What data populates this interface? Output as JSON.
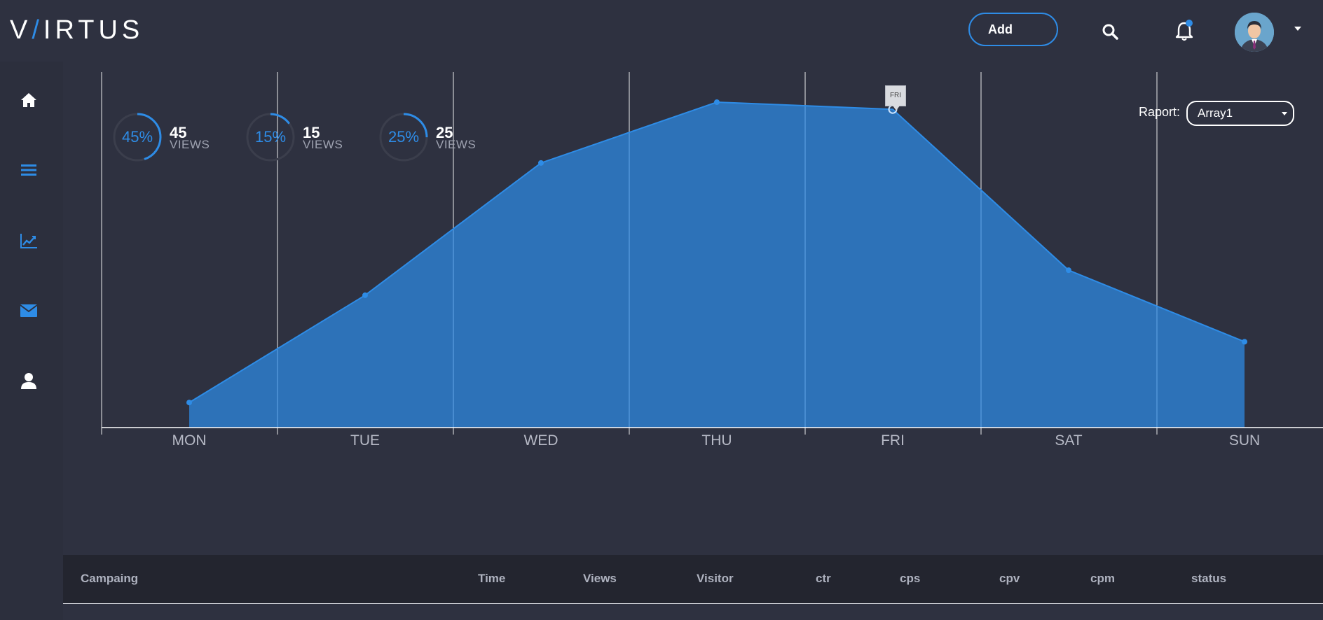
{
  "header": {
    "logo_pre": "V",
    "logo_slash": "/",
    "logo_post": "IRTUS",
    "add_label": "Add",
    "accent": "#2e8ce6"
  },
  "icons": {
    "search": "search-icon",
    "notifications": "bell-icon",
    "profile": "avatar",
    "menu": "chevron-down-icon"
  },
  "sidebar": {
    "items": [
      "home-icon",
      "list-icon",
      "chart-line-icon",
      "envelope-icon",
      "user-icon"
    ],
    "active_color": "#ffffff",
    "inactive_color": "#2e8ce6"
  },
  "gauges": [
    {
      "percent_label": "45%",
      "percent": 45,
      "value": "45",
      "unit": "VIEWS"
    },
    {
      "percent_label": "15%",
      "percent": 15,
      "value": "15",
      "unit": "VIEWS"
    },
    {
      "percent_label": "25%",
      "percent": 25,
      "value": "25",
      "unit": "VIEWS"
    }
  ],
  "report": {
    "label": "Raport:",
    "selected": "Array1"
  },
  "tooltip": {
    "label": "FRI"
  },
  "chart_data": {
    "type": "area",
    "categories": [
      "MON",
      "TUE",
      "WED",
      "THU",
      "FRI",
      "SAT",
      "SUN"
    ],
    "values": [
      7,
      37,
      74,
      91,
      89,
      44,
      24
    ],
    "ylim": [
      0,
      100
    ],
    "highlighted": "FRI",
    "color": "#2e8ce6"
  },
  "table": {
    "columns": [
      "Campaing",
      "Time",
      "Views",
      "Visitor",
      "ctr",
      "cps",
      "cpv",
      "cpm",
      "status"
    ]
  }
}
